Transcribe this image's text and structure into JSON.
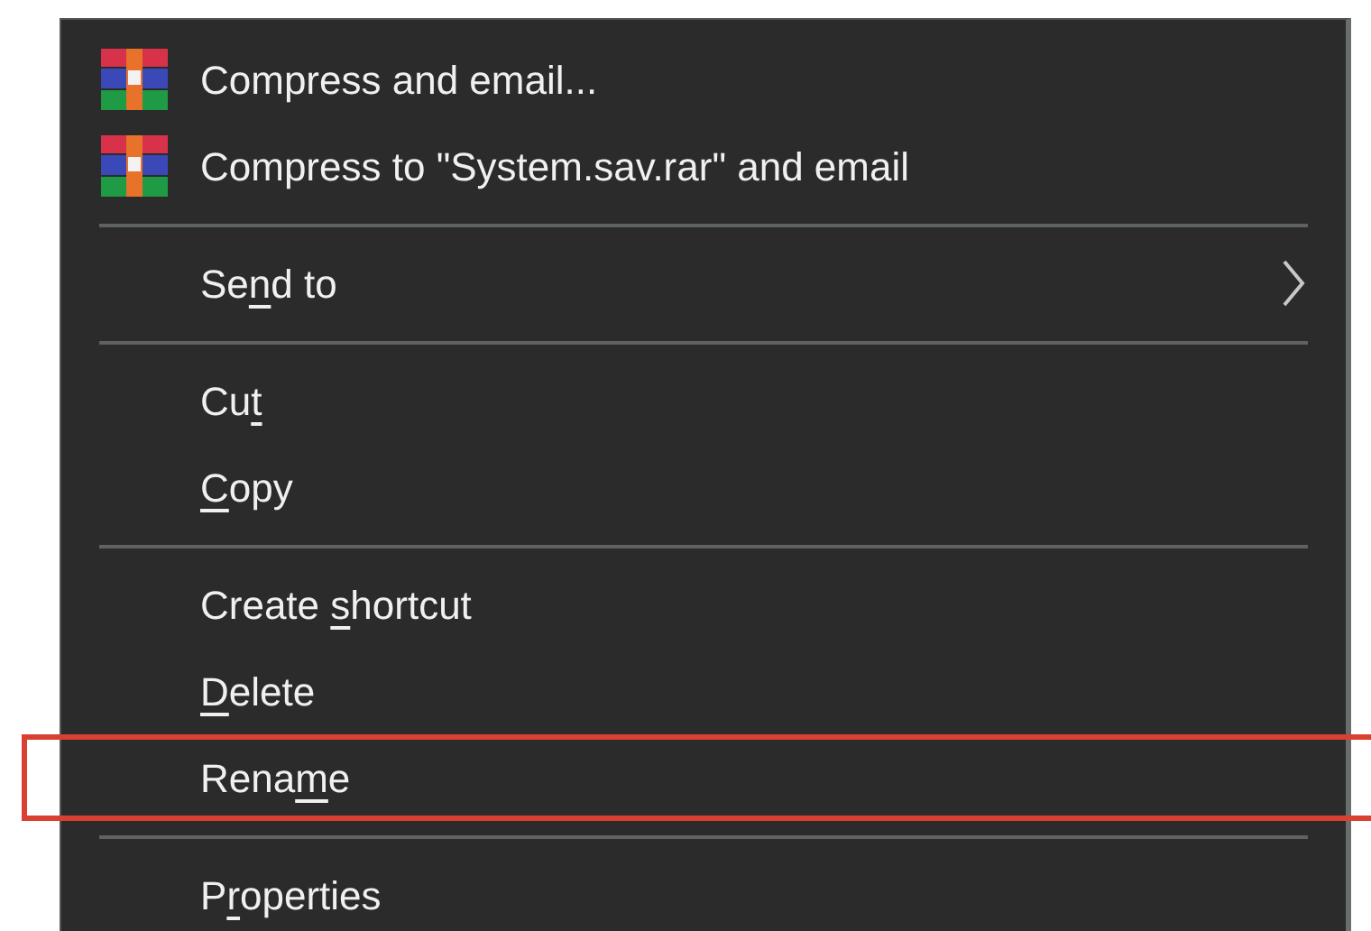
{
  "menu": {
    "items": [
      {
        "kind": "archive_command",
        "label": [
          {
            "text": "Compress and email...",
            "underlined": false
          }
        ],
        "highlighted": false
      },
      {
        "kind": "archive_command",
        "label": [
          {
            "text": "Compress to \"System.sav.rar\" and email",
            "underlined": false
          }
        ],
        "highlighted": false
      },
      {
        "kind": "separator"
      },
      {
        "kind": "submenu",
        "label": [
          {
            "text": "Se",
            "underlined": false
          },
          {
            "text": "n",
            "underlined": true
          },
          {
            "text": "d to",
            "underlined": false
          }
        ],
        "highlighted": false
      },
      {
        "kind": "separator"
      },
      {
        "kind": "command",
        "label": [
          {
            "text": "Cu",
            "underlined": false
          },
          {
            "text": "t",
            "underlined": true
          }
        ],
        "highlighted": false
      },
      {
        "kind": "command",
        "label": [
          {
            "text": "C",
            "underlined": true
          },
          {
            "text": "opy",
            "underlined": false
          }
        ],
        "highlighted": false
      },
      {
        "kind": "separator"
      },
      {
        "kind": "command",
        "label": [
          {
            "text": "Create ",
            "underlined": false
          },
          {
            "text": "s",
            "underlined": true
          },
          {
            "text": "hortcut",
            "underlined": false
          }
        ],
        "highlighted": false
      },
      {
        "kind": "command",
        "label": [
          {
            "text": "D",
            "underlined": true
          },
          {
            "text": "elete",
            "underlined": false
          }
        ],
        "highlighted": false
      },
      {
        "kind": "command",
        "label": [
          {
            "text": "Rena",
            "underlined": false
          },
          {
            "text": "m",
            "underlined": true
          },
          {
            "text": "e",
            "underlined": false
          }
        ],
        "highlighted": true
      },
      {
        "kind": "separator"
      },
      {
        "kind": "command",
        "label": [
          {
            "text": "P",
            "underlined": false
          },
          {
            "text": "r",
            "underlined": true
          },
          {
            "text": "operties",
            "underlined": false
          }
        ],
        "highlighted": false
      }
    ]
  }
}
